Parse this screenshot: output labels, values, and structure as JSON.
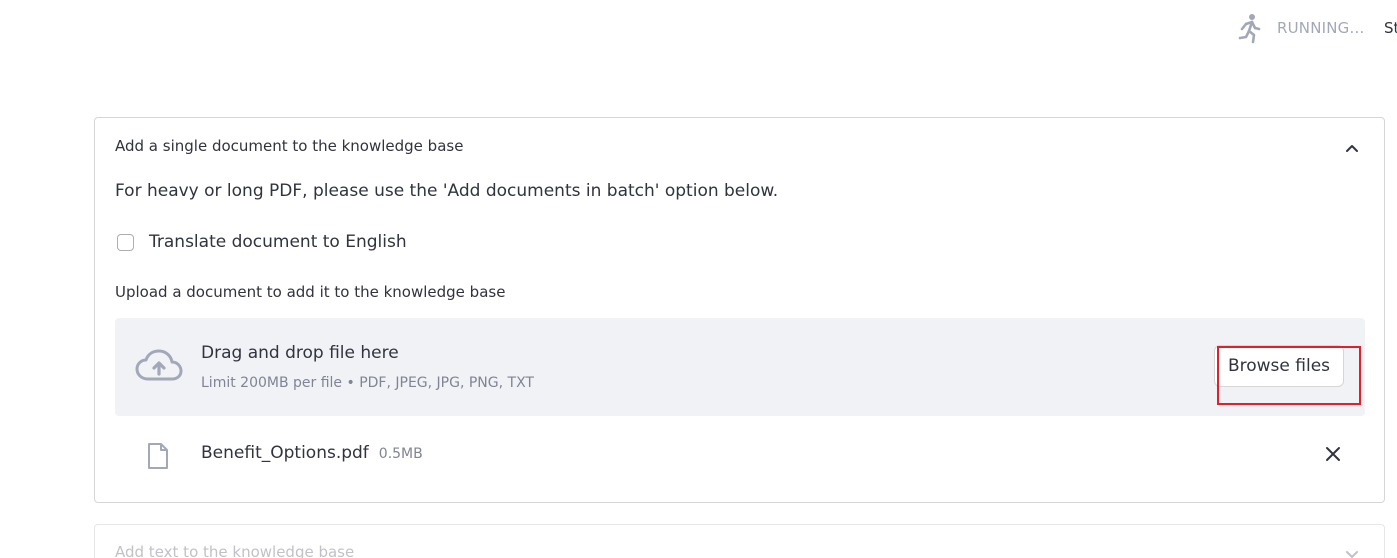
{
  "status": {
    "icon": "running-man-icon",
    "running_label": "RUNNING...",
    "stop_label": "St"
  },
  "expander_single": {
    "header": "Add a single document to the knowledge base",
    "chevron_icon": "chevron-up-icon",
    "info_text": "For heavy or long PDF, please use the 'Add documents in batch' option below.",
    "translate_checkbox": {
      "label": "Translate document to English",
      "checked": false
    },
    "upload": {
      "label": "Upload a document to add it to the knowledge base",
      "dropzone_title": "Drag and drop file here",
      "dropzone_subtitle": "Limit 200MB per file • PDF, JPEG, JPG, PNG, TXT",
      "browse_button": "Browse files",
      "cloud_icon": "cloud-upload-icon"
    },
    "uploaded_file": {
      "icon": "file-icon",
      "name": "Benefit_Options.pdf",
      "size": "0.5MB",
      "remove_icon": "close-icon"
    }
  },
  "expander_text": {
    "header": "Add text to the knowledge base",
    "chevron_icon": "chevron-down-icon"
  },
  "colors": {
    "highlight": "#e0202a",
    "dropzone_bg": "#f0f2f6",
    "text": "#31333f",
    "muted": "#808495"
  }
}
